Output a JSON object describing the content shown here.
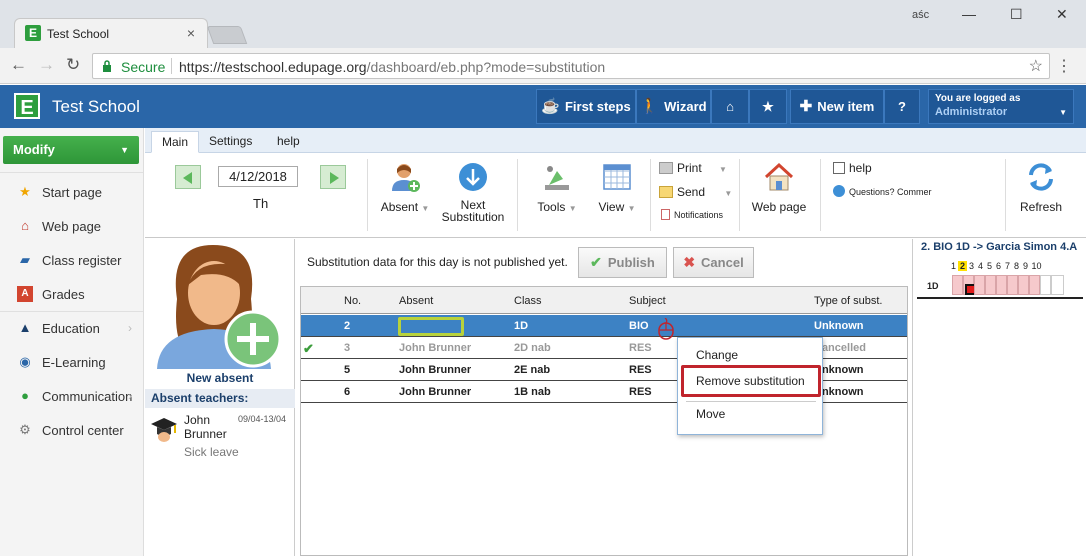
{
  "browser": {
    "tab_title": "Test School",
    "tab_close": "×",
    "window_user": "aśc",
    "window_controls": [
      "—",
      "☐",
      "✕"
    ],
    "secure_label": "Secure",
    "url_main": "https://testschool.edupage.org",
    "url_rest": "/dashboard/eb.php?mode=substitution"
  },
  "header": {
    "app_name": "Test School",
    "logo_letter": "E",
    "buttons": {
      "first_steps": "First steps",
      "wizard": "Wizard",
      "new_item": "New item",
      "help": "?"
    },
    "logged_in_label": "You are logged as",
    "logged_in_user": "Administrator"
  },
  "sidebar": {
    "modify_label": "Modify",
    "items": [
      {
        "label": "Start page"
      },
      {
        "label": "Web page"
      },
      {
        "label": "Class register"
      },
      {
        "label": "Grades"
      },
      {
        "label": "Education"
      },
      {
        "label": "E-Learning"
      },
      {
        "label": "Communication"
      },
      {
        "label": "Control center"
      }
    ]
  },
  "ribbon": {
    "tabs": [
      "Main",
      "Settings",
      "help"
    ],
    "date": "4/12/2018",
    "weekday": "Th",
    "absent_label": "Absent",
    "next_substitution_line1": "Next",
    "next_substitution_line2": "Substitution",
    "tools_label": "Tools",
    "view_label": "View",
    "print_label": "Print",
    "send_label": "Send",
    "notifications_label": "Notifications",
    "web_page_label": "Web page",
    "help_label": "help",
    "questions_label": "Questions? Commer",
    "refresh_label": "Refresh"
  },
  "absent_panel": {
    "new_absent_label": "New absent",
    "heading": "Absent teachers:",
    "teacher_first": "John",
    "teacher_last": "Brunner",
    "dates": "09/04-13/04",
    "reason": "Sick leave"
  },
  "main": {
    "notice": "Substitution data for this day is not published yet.",
    "publish_label": "Publish",
    "cancel_label": "Cancel",
    "columns": [
      "No.",
      "Absent",
      "Class",
      "Subject",
      "Type of subst."
    ],
    "rows": [
      {
        "no": "2",
        "absent": "",
        "class": "1D",
        "subject": "BIO",
        "type": "Unknown"
      },
      {
        "no": "3",
        "absent": "John Brunner",
        "class": "2D nab",
        "subject": "RES",
        "type": "Cancelled"
      },
      {
        "no": "5",
        "absent": "John Brunner",
        "class": "2E nab",
        "subject": "RES",
        "type": "Unknown"
      },
      {
        "no": "6",
        "absent": "John Brunner",
        "class": "1B nab",
        "subject": "RES",
        "type": "Unknown"
      }
    ]
  },
  "context_menu": {
    "items": [
      "Change",
      "Remove substitution",
      "Move"
    ]
  },
  "right_panel": {
    "title": "2. BIO 1D -> Garcia Simon 4.A",
    "periods": [
      "1",
      "2",
      "3",
      "4",
      "5",
      "6",
      "7",
      "8",
      "9",
      "10"
    ],
    "class_label": "1D"
  }
}
